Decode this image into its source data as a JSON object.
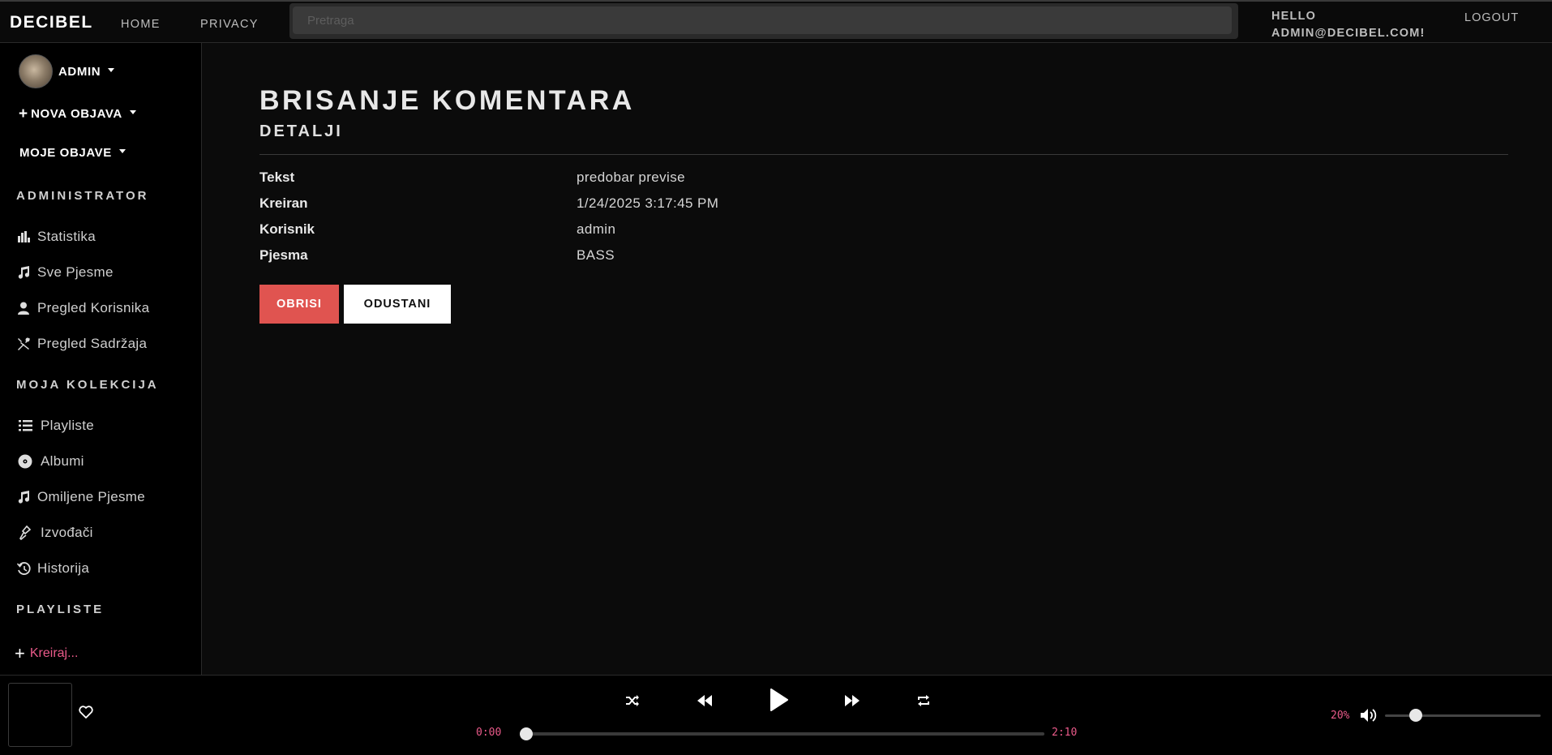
{
  "nav": {
    "brand": "DECIBEL",
    "links": [
      "HOME",
      "PRIVACY"
    ],
    "search_placeholder": "Pretraga",
    "hello_line1": "HELLO",
    "hello_line2": "ADMIN@DECIBEL.COM!",
    "logout": "LOGOUT"
  },
  "sidebar": {
    "user_label": "ADMIN",
    "new_post": "NOVA OBJAVA",
    "my_posts": "MOJE OBJAVE",
    "admin_heading": "ADMINISTRATOR",
    "admin_items": [
      {
        "label": "Statistika",
        "icon": "chart-bar-icon"
      },
      {
        "label": "Sve Pjesme",
        "icon": "music-note-icon"
      },
      {
        "label": "Pregled Korisnika",
        "icon": "user-icon"
      },
      {
        "label": "Pregled Sadržaja",
        "icon": "tools-icon"
      }
    ],
    "collection_heading": "MOJA KOLEKCIJA",
    "collection_items": [
      {
        "label": "Playliste",
        "icon": "list-icon"
      },
      {
        "label": "Albumi",
        "icon": "disc-icon"
      },
      {
        "label": "Omiljene Pjesme",
        "icon": "music-note-icon"
      },
      {
        "label": "Izvođači",
        "icon": "microphone-icon"
      },
      {
        "label": "Historija",
        "icon": "history-icon"
      }
    ],
    "playlists_heading": "PLAYLISTE",
    "create_label": "Kreiraj..."
  },
  "main": {
    "title": "BRISANJE KOMENTARA",
    "subtitle": "DETALJI",
    "details": [
      {
        "label": "Tekst",
        "value": "predobar previse"
      },
      {
        "label": "Kreiran",
        "value": "1/24/2025 3:17:45 PM"
      },
      {
        "label": "Korisnik",
        "value": "admin"
      },
      {
        "label": "Pjesma",
        "value": "BASS"
      }
    ],
    "delete_button": "OBRISI",
    "cancel_button": "ODUSTANI"
  },
  "player": {
    "current_time": "0:00",
    "total_time": "2:10",
    "progress": 0,
    "volume_label": "20%",
    "volume": 0.2
  },
  "colors": {
    "accent_pink": "#ea5a8a",
    "danger": "#e05450"
  }
}
